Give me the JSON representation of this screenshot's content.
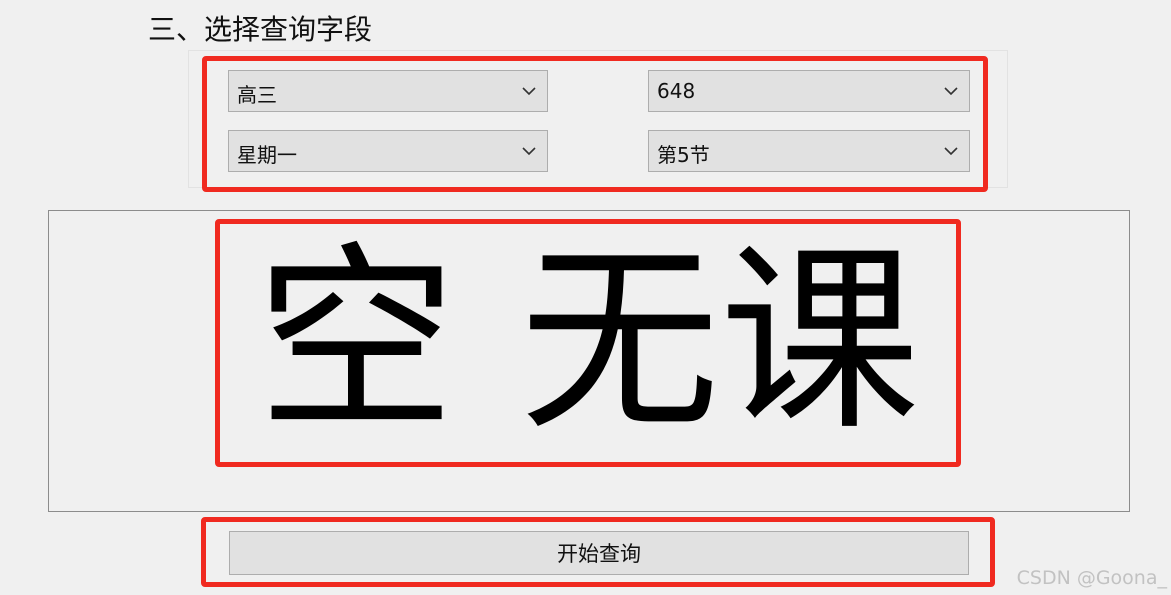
{
  "section": {
    "title": "三、选择查询字段"
  },
  "selectors": {
    "grade": {
      "value": "高三"
    },
    "room": {
      "value": "648"
    },
    "weekday": {
      "value": "星期一"
    },
    "period": {
      "value": "第5节"
    }
  },
  "result": {
    "text": "空 无课"
  },
  "actions": {
    "query_label": "开始查询"
  },
  "watermark": {
    "text": "CSDN @Goona_"
  },
  "icons": {
    "dropdown": "chevron-down-icon"
  },
  "colors": {
    "highlight": "#f02a20",
    "control_bg": "#e1e1e1",
    "control_border": "#adadad",
    "window_bg": "#f0f0f0"
  }
}
